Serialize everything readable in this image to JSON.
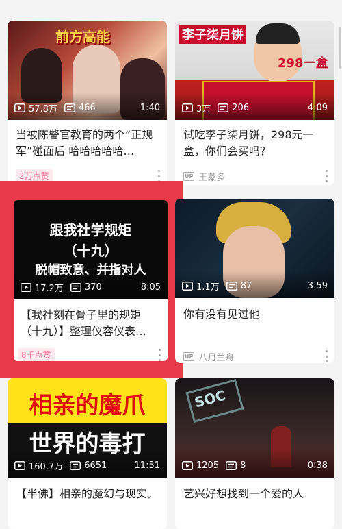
{
  "cards": [
    {
      "thumb_text": "前方高能",
      "views": "57.8万",
      "danmaku": "466",
      "duration": "1:40",
      "title": "当被陈警官教育的两个“正规军”碰面后 哈哈哈哈哈…",
      "badge": "2万点赞"
    },
    {
      "thumb_text": "李子柒月饼",
      "thumb_price": "298一盒",
      "views": "3万",
      "danmaku": "206",
      "duration": "4:09",
      "title": "试吃李子柒月饼，298元一盒，你们会买吗？",
      "uploader": "王蒙多"
    },
    {
      "thumb_line1": "跟我社学规矩",
      "thumb_line2": "（十九）",
      "thumb_line3": "脱帽致意、并指对人",
      "views": "17.2万",
      "danmaku": "370",
      "duration": "8:05",
      "title": "【我社刻在骨子里的规矩（十九）】整理仪容仪表…",
      "badge": "8千点赞"
    },
    {
      "views": "1.1万",
      "danmaku": "87",
      "duration": "3:59",
      "title": "你有没有见过他",
      "uploader": "八月兰舟"
    },
    {
      "thumb_line1": "相亲的魔爪",
      "thumb_line2": "世界的毒打",
      "views": "160.7万",
      "danmaku": "6651",
      "duration": "11:51",
      "title": "【半佛】相亲的魔幻与现实。"
    },
    {
      "thumb_text": "SOC",
      "views": "1205",
      "danmaku": "8",
      "duration": "0:38",
      "title": "艺兴好想找到一个爱的人"
    }
  ],
  "up_label": "UP",
  "colors": {
    "accent": "#fb7299",
    "overlay": "#e6283c"
  }
}
